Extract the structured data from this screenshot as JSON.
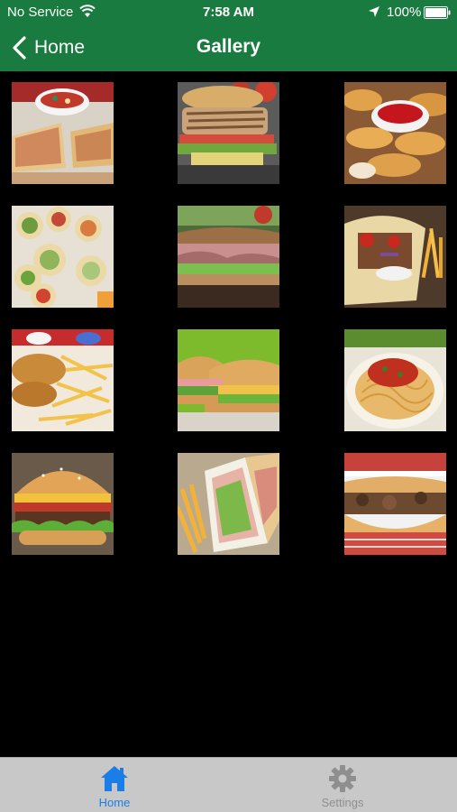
{
  "status_bar": {
    "carrier": "No Service",
    "time": "7:58 AM",
    "battery": "100%"
  },
  "nav": {
    "back_label": "Home",
    "title": "Gallery"
  },
  "gallery": {
    "items": [
      {
        "name": "quesadilla-salsa"
      },
      {
        "name": "grilled-chicken-sandwich"
      },
      {
        "name": "chicken-tenders-ketchup"
      },
      {
        "name": "wraps-platter"
      },
      {
        "name": "ham-sandwich"
      },
      {
        "name": "gyro-fries"
      },
      {
        "name": "fried-fish-fries"
      },
      {
        "name": "sub-sandwiches"
      },
      {
        "name": "spaghetti"
      },
      {
        "name": "cheeseburger"
      },
      {
        "name": "club-sandwich-fries"
      },
      {
        "name": "cheesesteak-sub"
      }
    ]
  },
  "tabbar": {
    "home_label": "Home",
    "settings_label": "Settings",
    "active_color": "#1a7ee6",
    "inactive_color": "#8f8f8f"
  },
  "colors": {
    "nav_bg": "#197b3f",
    "tabbar_bg": "#c8c8c8"
  }
}
